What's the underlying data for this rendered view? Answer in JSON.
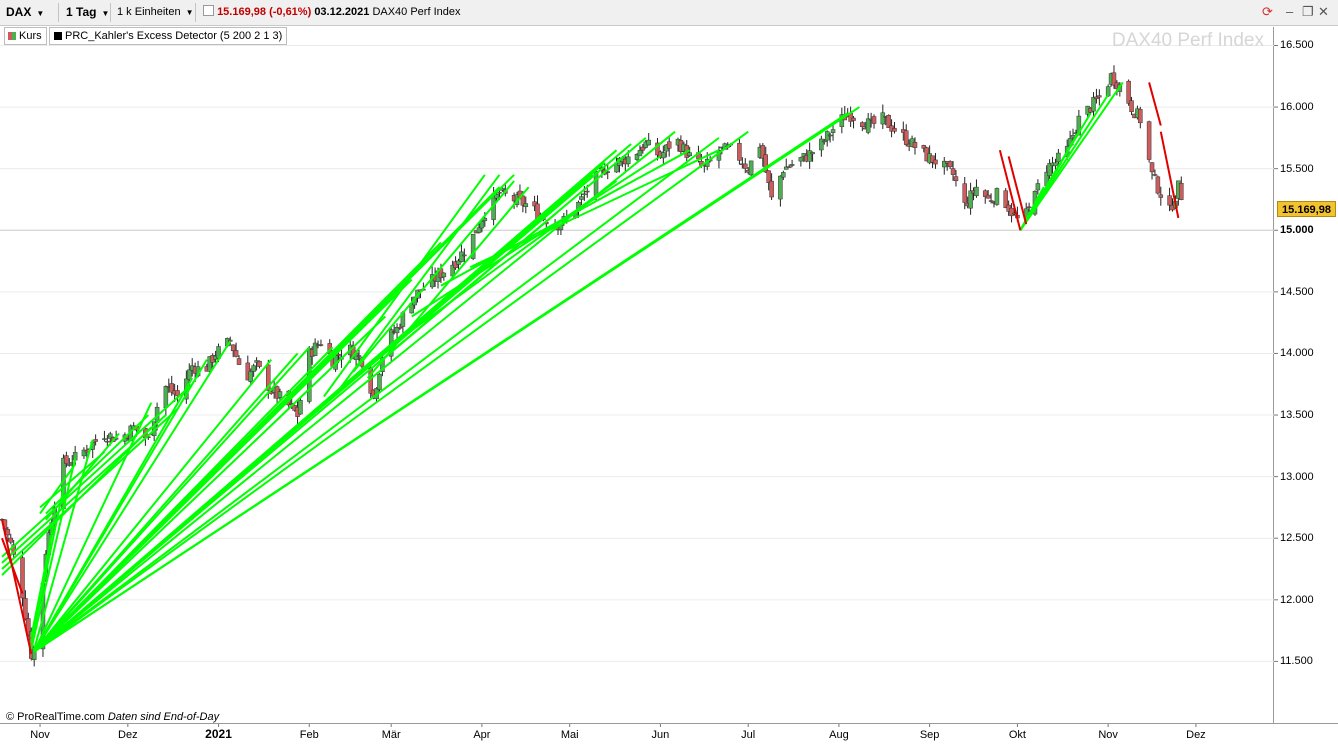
{
  "toolbar": {
    "symbol": "DAX",
    "period": "1 Tag",
    "units": "1 k Einheiten",
    "price": "15.169,98",
    "change": "(-0,61%)",
    "date": "03.12.2021",
    "instrument_name": "DAX40 Perf Index"
  },
  "legend": {
    "kurs": "Kurs",
    "indicator": "PRC_Kahler's Excess Detector (5 200 2 1 3)"
  },
  "watermark": "DAX40 Perf Index",
  "footer": {
    "brand": "© ProRealTime.com",
    "note": "Daten sind End-of-Day"
  },
  "last_price_label": "15.169,98",
  "colors": {
    "up": "#4caf50",
    "down": "#cd5c5c",
    "signal_up": "#00ff00",
    "signal_down": "#e00000",
    "price_tag": "#f2c230"
  },
  "chart_data": {
    "type": "candlestick",
    "title": "DAX40 Perf Index",
    "yticks": [
      "16.500",
      "16.000",
      "15.500",
      "15.000",
      "14.500",
      "14.000",
      "13.500",
      "13.000",
      "12.500",
      "12.000",
      "11.500"
    ],
    "ylim": [
      11000,
      16650
    ],
    "xticks": [
      "Nov",
      "Dez",
      "2021",
      "Feb",
      "Mär",
      "Apr",
      "Mai",
      "Jun",
      "Jul",
      "Aug",
      "Sep",
      "Okt",
      "Nov",
      "Dez"
    ],
    "x_tick_days": [
      13,
      43,
      74,
      105,
      133,
      164,
      194,
      225,
      255,
      286,
      317,
      347,
      378,
      408
    ],
    "x_range_days": [
      0,
      434
    ],
    "last_price": 15169.98,
    "close_anchors": [
      [
        0,
        12650
      ],
      [
        3,
        12450
      ],
      [
        7,
        12050
      ],
      [
        10,
        11560
      ],
      [
        12,
        11650
      ],
      [
        15,
        12400
      ],
      [
        18,
        12800
      ],
      [
        21,
        13100
      ],
      [
        25,
        13150
      ],
      [
        30,
        13250
      ],
      [
        35,
        13350
      ],
      [
        40,
        13300
      ],
      [
        45,
        13400
      ],
      [
        50,
        13300
      ],
      [
        55,
        13750
      ],
      [
        60,
        13650
      ],
      [
        65,
        13900
      ],
      [
        69,
        13850
      ],
      [
        73,
        14000
      ],
      [
        78,
        14100
      ],
      [
        83,
        13800
      ],
      [
        87,
        13900
      ],
      [
        92,
        13700
      ],
      [
        97,
        13600
      ],
      [
        101,
        13500
      ],
      [
        105,
        14000
      ],
      [
        109,
        14100
      ],
      [
        113,
        13950
      ],
      [
        118,
        14050
      ],
      [
        123,
        13950
      ],
      [
        127,
        13650
      ],
      [
        131,
        14100
      ],
      [
        135,
        14200
      ],
      [
        140,
        14450
      ],
      [
        145,
        14550
      ],
      [
        150,
        14650
      ],
      [
        155,
        14750
      ],
      [
        160,
        14900
      ],
      [
        165,
        15150
      ],
      [
        170,
        15300
      ],
      [
        175,
        15250
      ],
      [
        180,
        15200
      ],
      [
        185,
        15100
      ],
      [
        190,
        15050
      ],
      [
        194,
        15100
      ],
      [
        198,
        15250
      ],
      [
        202,
        15400
      ],
      [
        206,
        15500
      ],
      [
        210,
        15550
      ],
      [
        215,
        15600
      ],
      [
        220,
        15700
      ],
      [
        225,
        15600
      ],
      [
        230,
        15750
      ],
      [
        235,
        15600
      ],
      [
        240,
        15500
      ],
      [
        245,
        15650
      ],
      [
        250,
        15650
      ],
      [
        255,
        15500
      ],
      [
        259,
        15700
      ],
      [
        263,
        15250
      ],
      [
        267,
        15500
      ],
      [
        271,
        15550
      ],
      [
        275,
        15600
      ],
      [
        280,
        15700
      ],
      [
        285,
        15850
      ],
      [
        289,
        15950
      ],
      [
        293,
        15900
      ],
      [
        297,
        15850
      ],
      [
        301,
        15900
      ],
      [
        306,
        15800
      ],
      [
        311,
        15700
      ],
      [
        316,
        15600
      ],
      [
        320,
        15550
      ],
      [
        325,
        15450
      ],
      [
        329,
        15200
      ],
      [
        333,
        15350
      ],
      [
        337,
        15250
      ],
      [
        341,
        15300
      ],
      [
        345,
        15150
      ],
      [
        348,
        15050
      ],
      [
        352,
        15200
      ],
      [
        356,
        15500
      ],
      [
        360,
        15550
      ],
      [
        364,
        15650
      ],
      [
        368,
        15900
      ],
      [
        372,
        16000
      ],
      [
        376,
        16100
      ],
      [
        379,
        16250
      ],
      [
        383,
        16150
      ],
      [
        386,
        16000
      ],
      [
        389,
        15900
      ],
      [
        393,
        15450
      ],
      [
        396,
        15300
      ],
      [
        399,
        15150
      ],
      [
        402,
        15350
      ],
      [
        405,
        15150
      ]
    ],
    "signal_lines_up": [
      [
        [
          0,
          12200
        ],
        [
          51,
          13400
        ]
      ],
      [
        [
          0,
          12300
        ],
        [
          56,
          13500
        ]
      ],
      [
        [
          0,
          12250
        ],
        [
          60,
          13550
        ]
      ],
      [
        [
          0,
          12350
        ],
        [
          65,
          13750
        ]
      ],
      [
        [
          13,
          12700
        ],
        [
          25,
          13100
        ]
      ],
      [
        [
          13,
          12750
        ],
        [
          35,
          13200
        ]
      ],
      [
        [
          15,
          12650
        ],
        [
          40,
          13350
        ]
      ],
      [
        [
          15,
          12700
        ],
        [
          50,
          13500
        ]
      ],
      [
        [
          10,
          11700
        ],
        [
          18,
          12650
        ]
      ],
      [
        [
          10,
          11650
        ],
        [
          21,
          12900
        ]
      ],
      [
        [
          10,
          11600
        ],
        [
          25,
          13150
        ]
      ],
      [
        [
          11,
          11600
        ],
        [
          31,
          13300
        ]
      ],
      [
        [
          11,
          11580
        ],
        [
          51,
          13600
        ]
      ],
      [
        [
          11,
          11580
        ],
        [
          65,
          13800
        ]
      ],
      [
        [
          11,
          11580
        ],
        [
          70,
          13950
        ]
      ],
      [
        [
          11,
          11580
        ],
        [
          78,
          14100
        ]
      ],
      [
        [
          11,
          11580
        ],
        [
          92,
          13950
        ]
      ],
      [
        [
          11,
          11580
        ],
        [
          101,
          14000
        ]
      ],
      [
        [
          11,
          11580
        ],
        [
          105,
          14050
        ]
      ],
      [
        [
          11,
          11580
        ],
        [
          113,
          14050
        ]
      ],
      [
        [
          11,
          11580
        ],
        [
          120,
          14150
        ]
      ],
      [
        [
          11,
          11580
        ],
        [
          131,
          14300
        ]
      ],
      [
        [
          11,
          11580
        ],
        [
          140,
          14600
        ]
      ],
      [
        [
          11,
          11580
        ],
        [
          145,
          14750
        ]
      ],
      [
        [
          11,
          11580
        ],
        [
          150,
          14900
        ]
      ],
      [
        [
          11,
          11580
        ],
        [
          160,
          15100
        ]
      ],
      [
        [
          11,
          11580
        ],
        [
          170,
          15350
        ]
      ],
      [
        [
          11,
          11580
        ],
        [
          175,
          15450
        ]
      ],
      [
        [
          11,
          11580
        ],
        [
          202,
          15450
        ]
      ],
      [
        [
          11,
          11580
        ],
        [
          206,
          15550
        ]
      ],
      [
        [
          11,
          11580
        ],
        [
          210,
          15650
        ]
      ],
      [
        [
          11,
          11580
        ],
        [
          215,
          15700
        ]
      ],
      [
        [
          11,
          11580
        ],
        [
          220,
          15750
        ]
      ],
      [
        [
          11,
          11580
        ],
        [
          230,
          15800
        ]
      ],
      [
        [
          11,
          11580
        ],
        [
          245,
          15750
        ]
      ],
      [
        [
          11,
          11580
        ],
        [
          255,
          15800
        ]
      ],
      [
        [
          11,
          11580
        ],
        [
          289,
          15950
        ]
      ],
      [
        [
          11,
          11580
        ],
        [
          293,
          16000
        ]
      ],
      [
        [
          110,
          13650
        ],
        [
          165,
          15450
        ]
      ],
      [
        [
          115,
          13700
        ],
        [
          170,
          15450
        ]
      ],
      [
        [
          120,
          13850
        ],
        [
          175,
          15400
        ]
      ],
      [
        [
          125,
          13800
        ],
        [
          180,
          15350
        ]
      ],
      [
        [
          130,
          13950
        ],
        [
          190,
          15150
        ]
      ],
      [
        [
          135,
          14100
        ],
        [
          210,
          15400
        ]
      ],
      [
        [
          140,
          14300
        ],
        [
          225,
          15600
        ]
      ],
      [
        [
          150,
          14550
        ],
        [
          235,
          15650
        ]
      ],
      [
        [
          160,
          14700
        ],
        [
          245,
          15650
        ]
      ],
      [
        [
          348,
          15000
        ],
        [
          356,
          15350
        ]
      ],
      [
        [
          348,
          15000
        ],
        [
          362,
          15550
        ]
      ],
      [
        [
          348,
          15000
        ],
        [
          368,
          15800
        ]
      ],
      [
        [
          348,
          15000
        ],
        [
          372,
          15950
        ]
      ],
      [
        [
          348,
          15000
        ],
        [
          378,
          16100
        ]
      ],
      [
        [
          348,
          15000
        ],
        [
          383,
          16200
        ]
      ]
    ],
    "signal_lines_down": [
      [
        [
          0,
          12650
        ],
        [
          10,
          11560
        ]
      ],
      [
        [
          0,
          12500
        ],
        [
          7,
          12050
        ]
      ],
      [
        [
          341,
          15650
        ],
        [
          348,
          15000
        ]
      ],
      [
        [
          344,
          15600
        ],
        [
          350,
          15050
        ]
      ],
      [
        [
          392,
          16200
        ],
        [
          396,
          15850
        ]
      ],
      [
        [
          396,
          15800
        ],
        [
          402,
          15100
        ]
      ]
    ]
  }
}
